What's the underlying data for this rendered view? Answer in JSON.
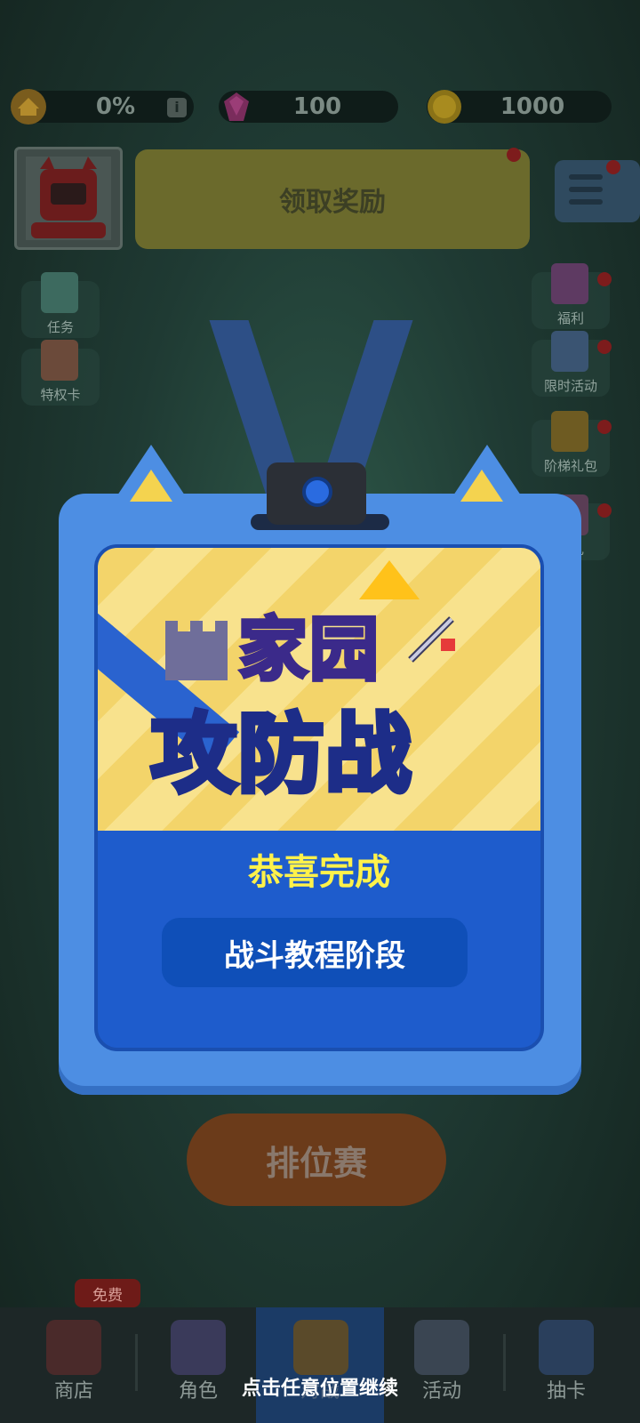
{
  "resources": {
    "progress": {
      "icon": "home-level-icon",
      "value": "0%",
      "info": "i"
    },
    "gems": {
      "icon": "gem-icon",
      "value": "100"
    },
    "coins": {
      "icon": "coin-icon",
      "value": "1000"
    }
  },
  "header": {
    "reward_button": "领取奖励"
  },
  "side_left": [
    {
      "label": "任务",
      "icon": "task-icon"
    },
    {
      "label": "特权卡",
      "icon": "vip-card-icon"
    }
  ],
  "side_right": [
    {
      "label": "福利",
      "icon": "gift-icon"
    },
    {
      "label": "限时活动",
      "icon": "timer-gift-icon"
    },
    {
      "label": "阶梯礼包",
      "icon": "ladder-gift-icon"
    },
    {
      "label": "有礼",
      "icon": "gift-box-icon"
    }
  ],
  "modal": {
    "logo_line1": "家园",
    "logo_line2": "攻防战",
    "congrats": "恭喜完成",
    "stage": "战斗教程阶段"
  },
  "rank_button": "排位赛",
  "bottom_nav": {
    "free_tag": "免费",
    "items": [
      {
        "label": "商店",
        "icon": "shop-icon"
      },
      {
        "label": "角色",
        "icon": "character-icon"
      },
      {
        "label": "对战",
        "icon": "crossed-swords-icon"
      },
      {
        "label": "活动",
        "icon": "lock-icon"
      },
      {
        "label": "抽卡",
        "icon": "mystery-card-icon"
      }
    ]
  },
  "hint": "点击任意位置继续",
  "colors": {
    "card_blue": "#4d8ee3",
    "congrats_yellow": "#fff24a",
    "reward_yellow": "#6b6a2c"
  }
}
